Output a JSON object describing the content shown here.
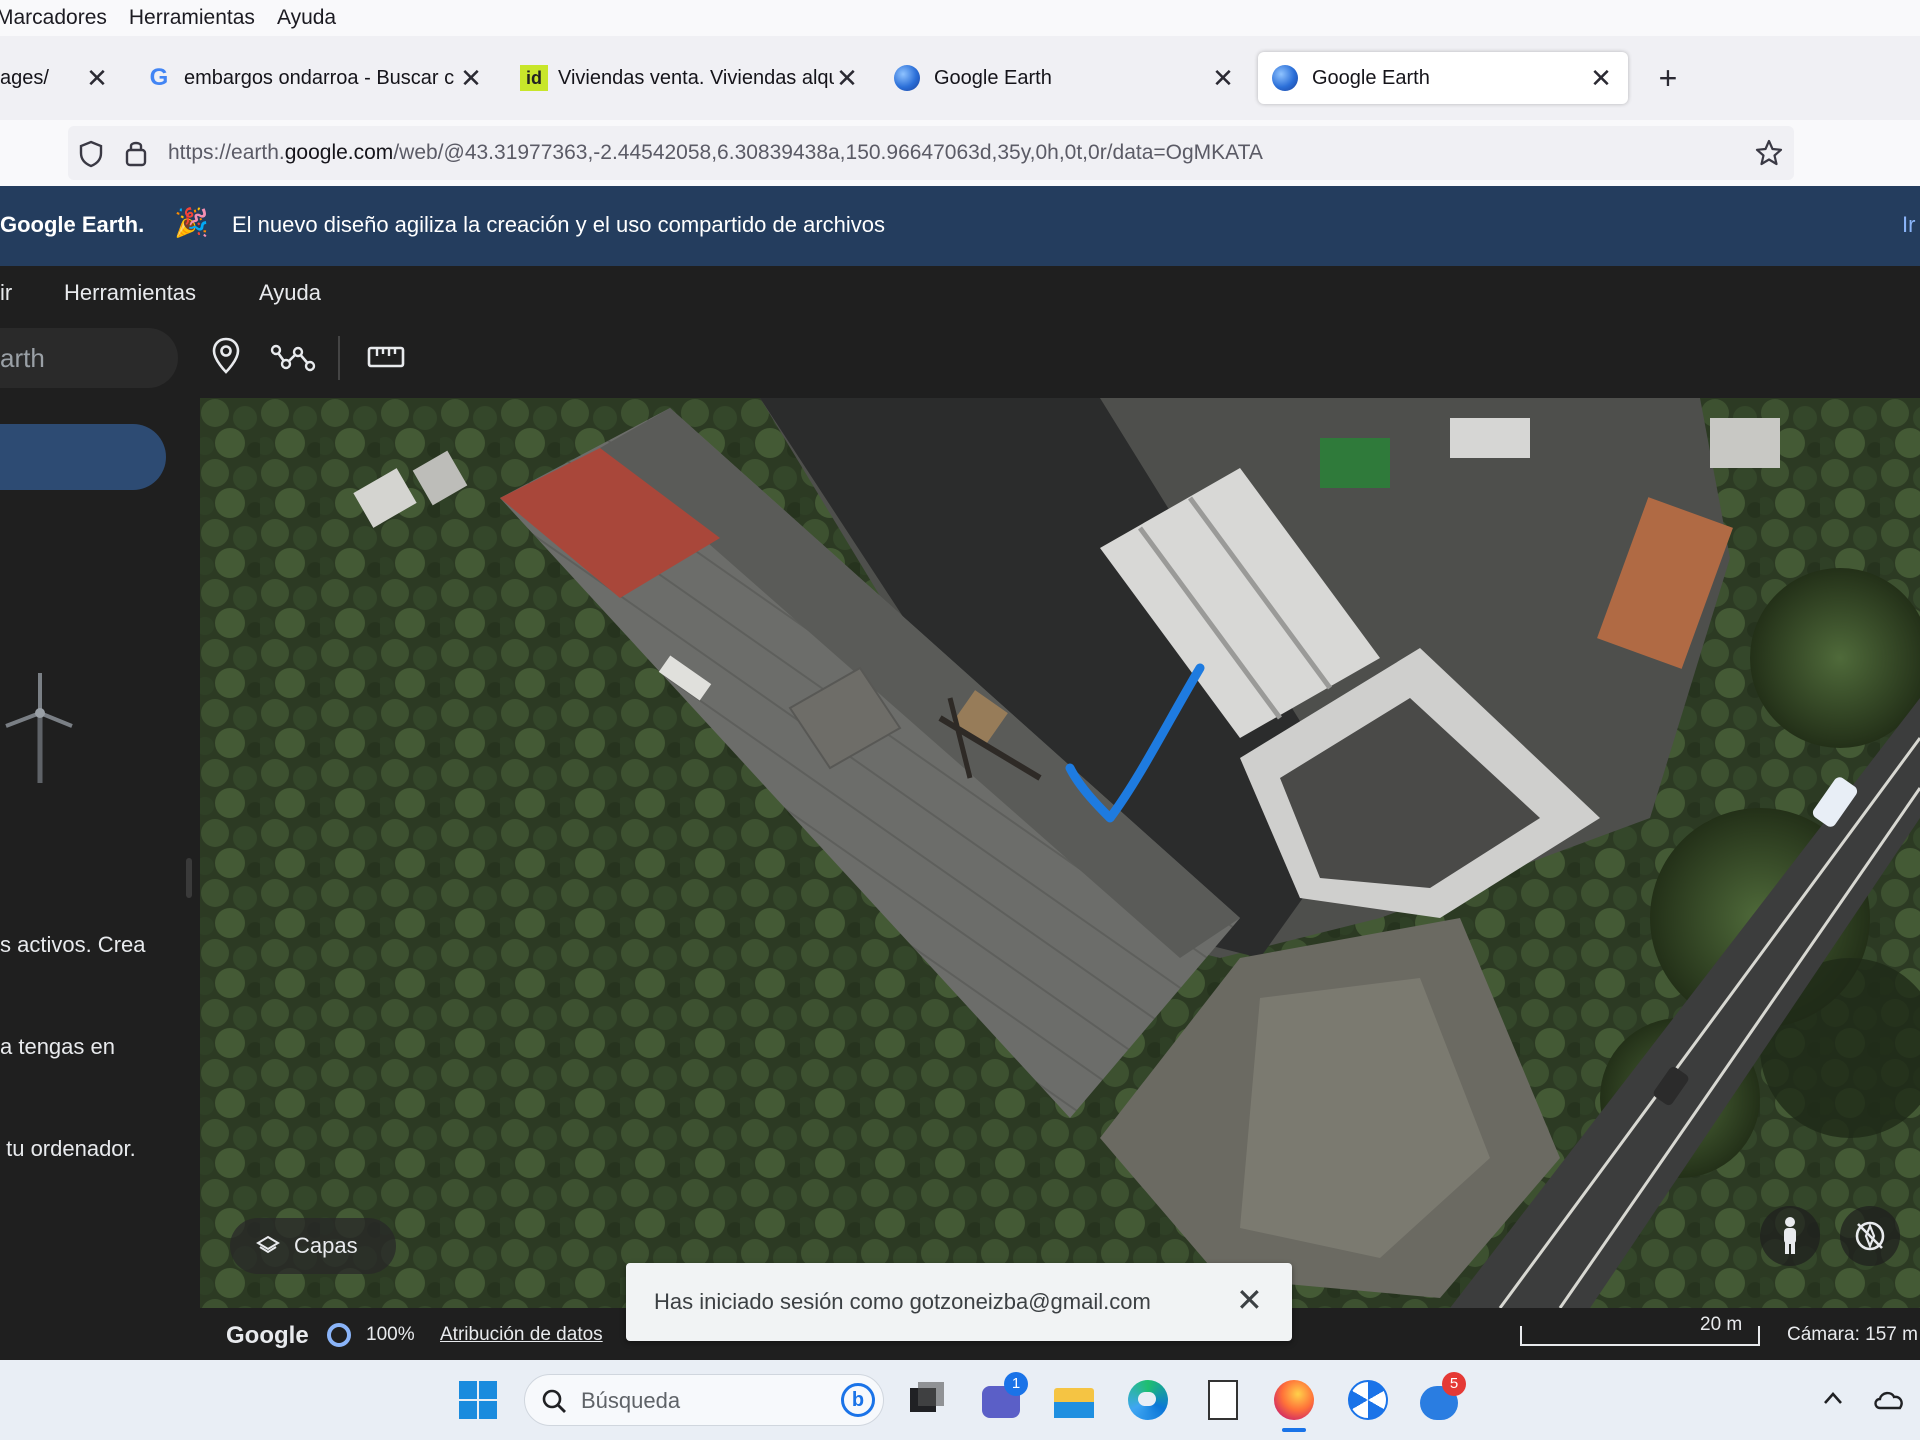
{
  "browser": {
    "menu": [
      "Marcadores",
      "Herramientas",
      "Ayuda"
    ],
    "tabs": [
      {
        "label": "ages/",
        "favicon": "none"
      },
      {
        "label": "embargos ondarroa - Buscar co",
        "favicon": "google-g-icon"
      },
      {
        "label": "Viviendas venta. Viviendas alqu",
        "favicon": "idealista-icon"
      },
      {
        "label": "Google Earth",
        "favicon": "earth-icon"
      },
      {
        "label": "Google Earth",
        "favicon": "earth-icon",
        "active": true
      }
    ],
    "url_prefix": "https://earth.",
    "url_domain": "google.com",
    "url_rest": "/web/@43.31977363,-2.44542058,6.30839438a,150.96647063d,35y,0h,0t,0r/data=OgMKATA"
  },
  "earth": {
    "banner_brand": "Google Earth.",
    "banner_message": "El nuevo diseño agiliza la creación y el uso compartido de archivos",
    "banner_link": "Ir",
    "menu": [
      "ir",
      "Herramientas",
      "Ayuda"
    ],
    "search_placeholder": "arth",
    "sidebar_text": [
      "s activos. Crea",
      "a tengas en",
      " tu ordenador."
    ],
    "layers_label": "Capas",
    "status": {
      "brand": "Google",
      "zoom": "100%",
      "attribution": "Atribución de datos",
      "scale": "20 m",
      "camera": "Cámara: 157 m"
    },
    "toast": "Has iniciado sesión como gotzoneizba@gmail.com"
  },
  "taskbar": {
    "search_placeholder": "Búsqueda",
    "badges": {
      "teams": "1",
      "app": "5"
    }
  },
  "colors": {
    "banner_bg": "#243d5e",
    "earth_bg": "#1f1f1f",
    "checkmark": "#1e7be0"
  }
}
